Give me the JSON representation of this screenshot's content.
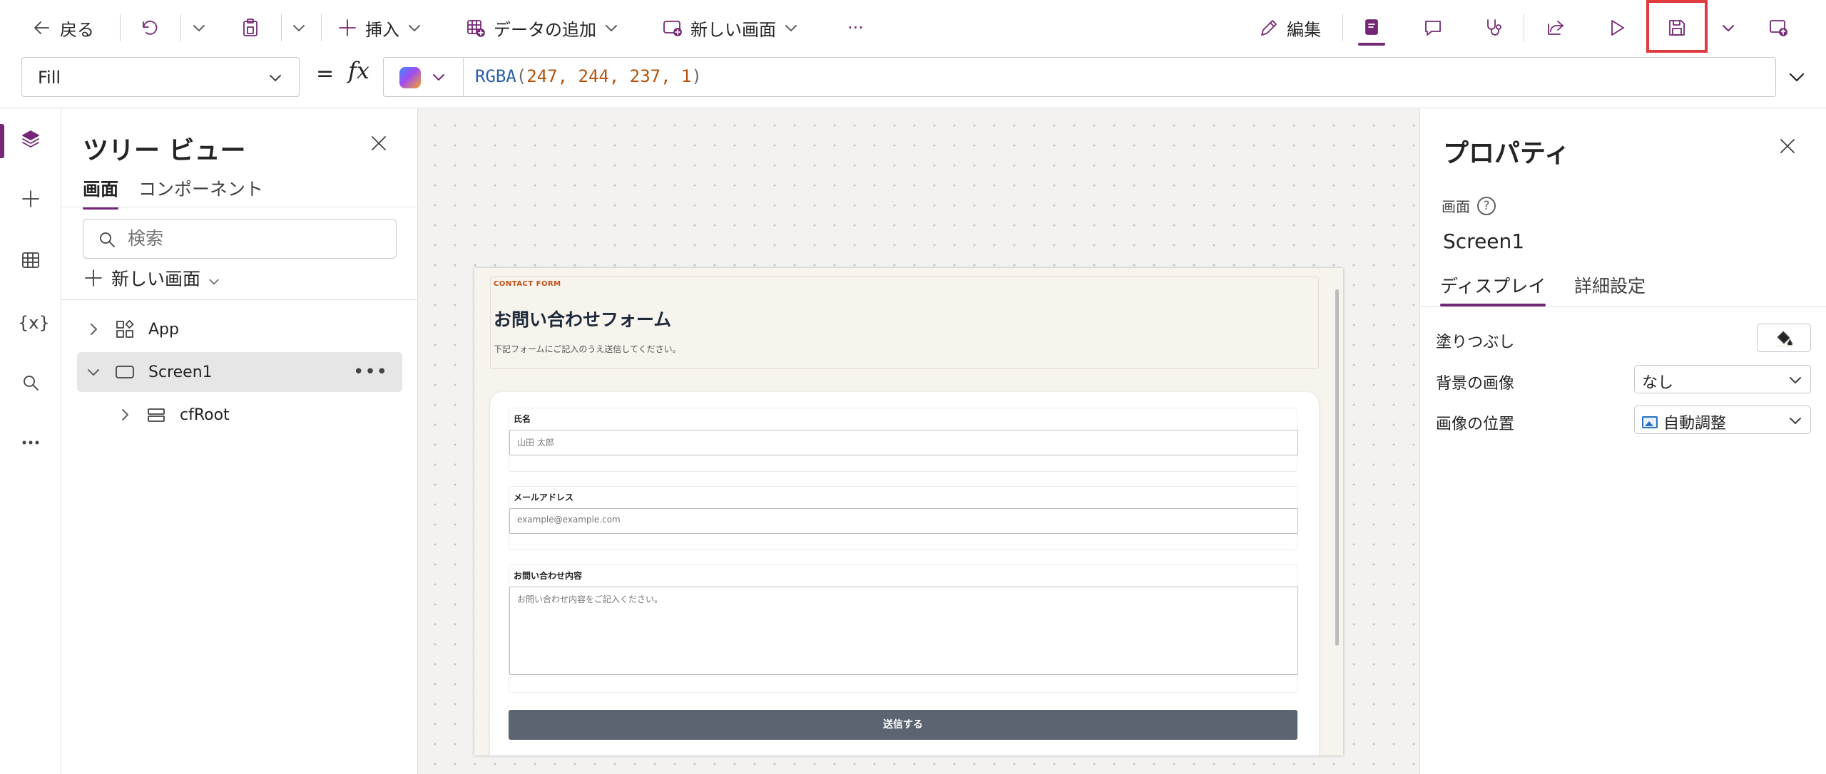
{
  "toolbar": {
    "back": "戻る",
    "insert": "挿入",
    "add_data": "データの追加",
    "new_screen": "新しい画面",
    "more": "···",
    "edit": "編集"
  },
  "formula_bar": {
    "property": "Fill",
    "equals": "=",
    "fx": "fx",
    "formula_fn": "RGBA",
    "formula_args": "247, 244, 237, 1"
  },
  "tree_view": {
    "title": "ツリー ビュー",
    "tabs": [
      "画面",
      "コンポーネント"
    ],
    "search_placeholder": "検索",
    "new_screen": "新しい画面",
    "nodes": [
      "App",
      "Screen1",
      "cfRoot"
    ]
  },
  "rail": {
    "variables_label": "{x}"
  },
  "screen_preview": {
    "label": "CONTACT FORM",
    "title": "お問い合わせフォーム",
    "subtitle": "下記フォームにご記入のうえ送信してください。",
    "fields": [
      {
        "label": "氏名",
        "placeholder": "山田 太郎"
      },
      {
        "label": "メールアドレス",
        "placeholder": "example@example.com"
      },
      {
        "label": "お問い合わせ内容",
        "placeholder": "お問い合わせ内容をご記入ください。"
      }
    ],
    "submit": "送信する",
    "background": "#f7f4ed"
  },
  "properties": {
    "title": "プロパティ",
    "type": "画面",
    "help": "?",
    "name": "Screen1",
    "tabs": [
      "ディスプレイ",
      "詳細設定"
    ],
    "rows": {
      "fill": "塗りつぶし",
      "bg_image": "背景の画像",
      "bg_image_value": "なし",
      "image_position": "画像の位置",
      "image_position_value": "自動調整"
    }
  },
  "colors": {
    "accent": "#742774",
    "highlight": "#e0393e",
    "submit_button": "#5a6571"
  }
}
